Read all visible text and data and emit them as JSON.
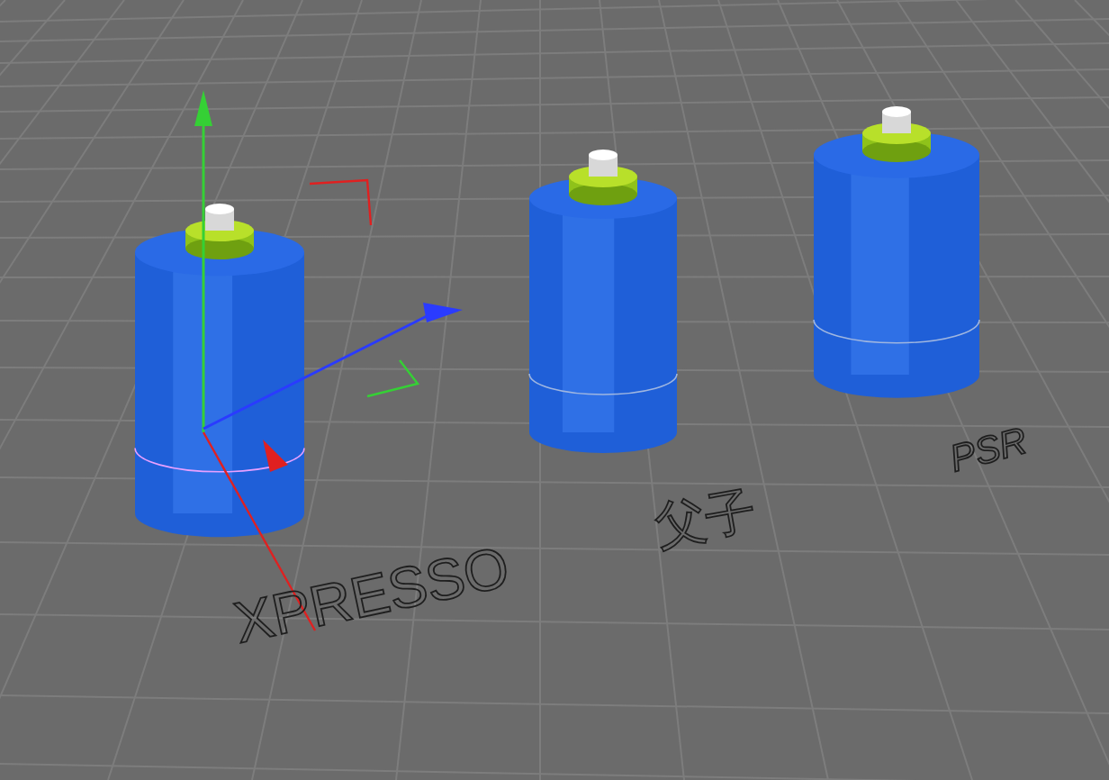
{
  "scene": {
    "objects": [
      {
        "selected": true
      },
      {
        "selected": false
      },
      {
        "selected": false
      }
    ],
    "labels": [
      {
        "text": "XPRESSO"
      },
      {
        "text": "父子"
      },
      {
        "text": "PSR"
      }
    ]
  }
}
